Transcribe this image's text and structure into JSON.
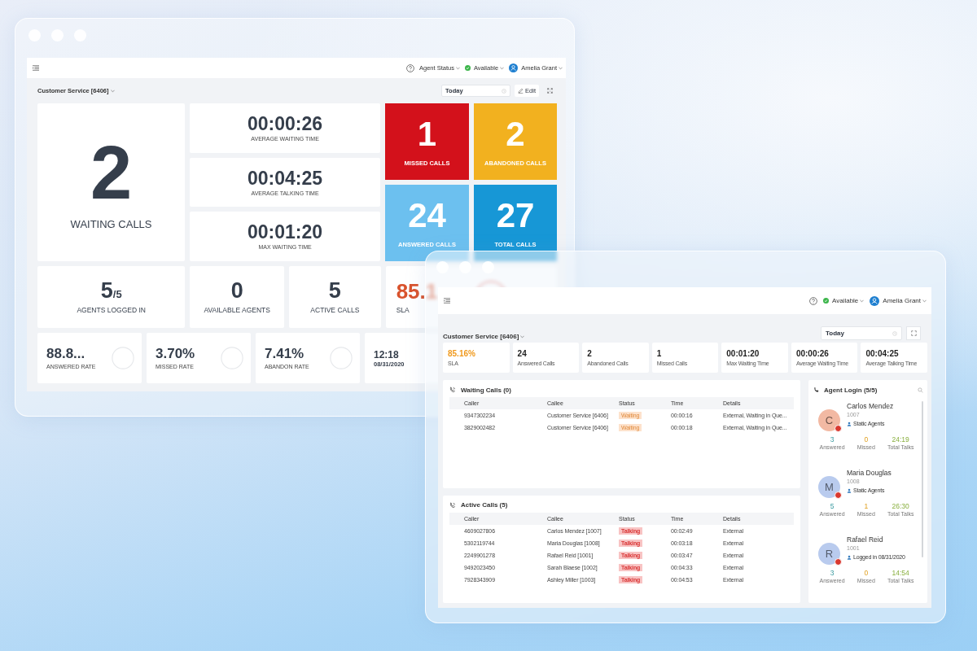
{
  "back_window": {
    "header": {
      "agent_status": "Agent Status",
      "availability": "Available",
      "user": "Amelia Grant"
    },
    "queue": "Customer Service [6406]",
    "date_range": "Today",
    "edit": "Edit",
    "waiting_calls": {
      "value": "2",
      "label": "WAITING CALLS"
    },
    "times": [
      {
        "value": "00:00:26",
        "label": "AVERAGE WAITING TIME"
      },
      {
        "value": "00:04:25",
        "label": "AVERAGE TALKING TIME"
      },
      {
        "value": "00:01:20",
        "label": "MAX WAITING TIME"
      }
    ],
    "call_tiles": [
      {
        "value": "1",
        "label": "MISSED CALLS",
        "color": "#d3111b"
      },
      {
        "value": "2",
        "label": "ABANDONED CALLS",
        "color": "#f2b11f"
      },
      {
        "value": "24",
        "label": "ANSWERED CALLS",
        "color": "#6cc0ef"
      },
      {
        "value": "27",
        "label": "TOTAL CALLS",
        "color": "#1797d6"
      }
    ],
    "agents_logged_in": {
      "value": "5",
      "total": "/5",
      "label": "AGENTS LOGGED IN"
    },
    "counts": [
      {
        "value": "0",
        "label": "AVAILABLE AGENTS"
      },
      {
        "value": "5",
        "label": "ACTIVE CALLS"
      }
    ],
    "sla": {
      "value": "85.1",
      "label": "SLA"
    },
    "rates": [
      {
        "value": "88.8...",
        "label": "ANSWERED RATE"
      },
      {
        "value": "3.70%",
        "label": "MISSED RATE"
      },
      {
        "value": "7.41%",
        "label": "ABANDON RATE"
      }
    ],
    "clock": {
      "time": "12:18",
      "date": "08/31/2020"
    }
  },
  "front_window": {
    "header": {
      "availability": "Available",
      "user": "Amelia Grant"
    },
    "queue": "Customer Service [6406]",
    "date_range": "Today",
    "stats": [
      {
        "value": "85.16%",
        "label": "SLA",
        "kind": "sla"
      },
      {
        "value": "24",
        "label": "Answered Calls",
        "kind": "plain"
      },
      {
        "value": "2",
        "label": "Abandoned Calls",
        "kind": "plain"
      },
      {
        "value": "1",
        "label": "Missed Calls",
        "kind": "plain"
      },
      {
        "value": "00:01:20",
        "label": "Max Waiting Time",
        "kind": "plain"
      },
      {
        "value": "00:00:26",
        "label": "Average Waiting Time",
        "kind": "plain"
      },
      {
        "value": "00:04:25",
        "label": "Average Talking Time",
        "kind": "plain"
      }
    ],
    "tables": [
      {
        "title": "Waiting Calls (0)",
        "kind": "waiting",
        "columns": [
          "Caller",
          "Callee",
          "Status",
          "Time",
          "Details"
        ],
        "rows": [
          {
            "caller": "9347302234",
            "callee": "Customer Service [6406]",
            "status": "Waiting",
            "time": "00:00:16",
            "details": "External, Waiting in Que..."
          },
          {
            "caller": "3829002482",
            "callee": "Customer Service [6406]",
            "status": "Waiting",
            "time": "00:00:18",
            "details": "External, Waiting in Que..."
          }
        ]
      },
      {
        "title": "Active Calls (5)",
        "kind": "active",
        "columns": [
          "Caller",
          "Callee",
          "Status",
          "Time",
          "Details"
        ],
        "rows": [
          {
            "caller": "4609027806",
            "callee": "Carlos Mendez [1007]",
            "status": "Talking",
            "time": "00:02:49",
            "details": "External"
          },
          {
            "caller": "5302119744",
            "callee": "Maria Douglas [1008]",
            "status": "Talking",
            "time": "00:03:18",
            "details": "External"
          },
          {
            "caller": "2249901278",
            "callee": "Rafael Reid [1001]",
            "status": "Talking",
            "time": "00:03:47",
            "details": "External"
          },
          {
            "caller": "9492023450",
            "callee": "Sarah Blaese [1002]",
            "status": "Talking",
            "time": "00:04:33",
            "details": "External"
          },
          {
            "caller": "7928343909",
            "callee": "Ashley Miller [1003]",
            "status": "Talking",
            "time": "00:04:53",
            "details": "External"
          }
        ]
      }
    ],
    "agent_login": {
      "title": "Agent Login (5/5)",
      "agents": [
        {
          "initial": "C",
          "name": "Carlos Mendez",
          "ext": "1007",
          "tag": "Static Agents",
          "color": "#f2b9a3",
          "stats": [
            {
              "value": "3",
              "label": "Answered"
            },
            {
              "value": "0",
              "label": "Missed"
            },
            {
              "value": "24:19",
              "label": "Total Talks"
            }
          ]
        },
        {
          "initial": "M",
          "name": "Maria Douglas",
          "ext": "1008",
          "tag": "Static Agents",
          "color": "#b9cbee",
          "stats": [
            {
              "value": "5",
              "label": "Answered"
            },
            {
              "value": "1",
              "label": "Missed"
            },
            {
              "value": "26:30",
              "label": "Total Talks"
            }
          ]
        },
        {
          "initial": "R",
          "name": "Rafael Reid",
          "ext": "1001",
          "tag": "Logged in 08/31/2020",
          "color": "#b9cbee",
          "stats": [
            {
              "value": "3",
              "label": "Answered"
            },
            {
              "value": "0",
              "label": "Missed"
            },
            {
              "value": "14:54",
              "label": "Total Talks"
            }
          ]
        }
      ]
    }
  }
}
